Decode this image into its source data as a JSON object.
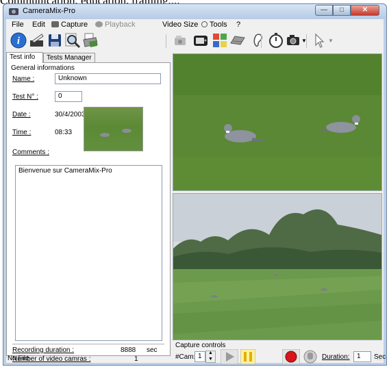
{
  "caption": "Communication, education, training,...",
  "window": {
    "title": "CameraMix-Pro"
  },
  "menu": {
    "file": "File",
    "edit": "Edit",
    "capture": "Capture",
    "playback": "Playback",
    "video_size": "Video Size",
    "tools": "Tools",
    "help": "?"
  },
  "toolbar": {
    "icons": [
      "info-icon",
      "edit-icon",
      "save-icon",
      "search-icon",
      "print-icon",
      "camera-off-icon",
      "tv-icon",
      "multi-view-icon",
      "tape-icon",
      "ear-icon",
      "stopwatch-icon",
      "camera-icon",
      "cursor-icon"
    ],
    "colors": {
      "info_blue": "#2a6fd0",
      "record_red": "#d6161c"
    }
  },
  "tabs": {
    "test_info": "Test info",
    "tests_manager": "Tests Manager"
  },
  "info": {
    "group_title": "General informations",
    "name_label": "Name :",
    "name_value": "Unknown",
    "test_no_label": "Test N° :",
    "test_no_value": "0",
    "date_label": "Date :",
    "date_value": "30/4/2003",
    "time_label": "Time :",
    "time_value": "08:33",
    "comments_label": "Comments :",
    "comments_value": "Bienvenue sur  CameraMix-Pro",
    "recording_duration_label": "Recording duration :",
    "recording_duration_value": "8888",
    "recording_duration_unit": "sec",
    "num_cameras_label": "Number of video camras :",
    "num_cameras_value": "1"
  },
  "capture": {
    "title": "Capture controls",
    "cam_label": "#Cam:",
    "cam_value": "1",
    "duration_label": "Duration:",
    "duration_value": "1",
    "duration_unit": "Sec"
  },
  "status": {
    "text": "No File"
  }
}
